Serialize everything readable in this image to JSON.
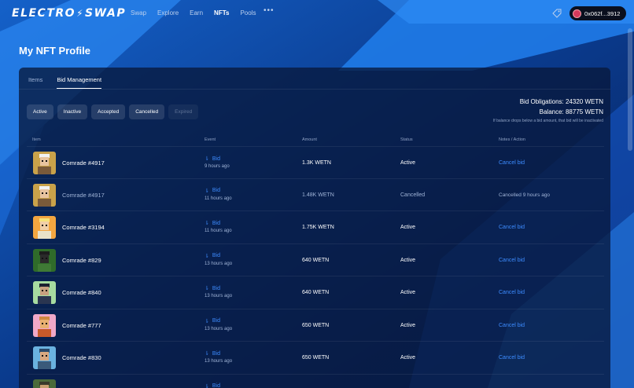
{
  "nav": {
    "logo_left": "ELECTRO",
    "logo_right": "SWAP",
    "links": [
      {
        "label": "Swap",
        "active": false
      },
      {
        "label": "Explore",
        "active": false
      },
      {
        "label": "Earn",
        "active": false
      },
      {
        "label": "NFTs",
        "active": true
      },
      {
        "label": "Pools",
        "active": false
      }
    ],
    "more_label": "•••",
    "wallet_address": "0x062f...3912"
  },
  "page": {
    "title": "My NFT Profile"
  },
  "tabs": [
    {
      "label": "Items",
      "active": false
    },
    {
      "label": "Bid Management",
      "active": true
    }
  ],
  "filters": [
    {
      "label": "Active",
      "disabled": false
    },
    {
      "label": "Inactive",
      "disabled": false
    },
    {
      "label": "Accepted",
      "disabled": false
    },
    {
      "label": "Cancelled",
      "disabled": false
    },
    {
      "label": "Expired",
      "disabled": true
    }
  ],
  "summary": {
    "obligations": "Bid Obligations: 24320 WETN",
    "balance": "Balance: 88775 WETN",
    "note": "If balance drops below a bid amount, that bid will be inactivated"
  },
  "table": {
    "headers": {
      "item": "Item",
      "event": "Event",
      "amount": "Amount",
      "status": "Status",
      "notes": "Notes / Action"
    },
    "rows": [
      {
        "name": "Comrade #4917",
        "event": "Bid",
        "time": "9 hours ago",
        "amount": "1.3K WETN",
        "status": "Active",
        "action": "Cancel bid",
        "muted": false,
        "avatar": {
          "bg": "#c9a24a",
          "skin": "#e8c4a0",
          "hair": "#f2f2f2",
          "shirt": "#7a5a3a"
        }
      },
      {
        "name": "Comrade #4917",
        "event": "Bid",
        "time": "11 hours ago",
        "amount": "1.48K WETN",
        "status": "Cancelled",
        "action": "Cancelled 9 hours ago",
        "muted": true,
        "avatar": {
          "bg": "#c9a24a",
          "skin": "#e8c4a0",
          "hair": "#f2f2f2",
          "shirt": "#7a5a3a"
        }
      },
      {
        "name": "Comrade #3194",
        "event": "Bid",
        "time": "11 hours ago",
        "amount": "1.75K WETN",
        "status": "Active",
        "action": "Cancel bid",
        "muted": false,
        "avatar": {
          "bg": "#f3a640",
          "skin": "#f0cfa8",
          "hair": "#f6e27a",
          "shirt": "#e9e1c8"
        }
      },
      {
        "name": "Comrade #829",
        "event": "Bid",
        "time": "13 hours ago",
        "amount": "640 WETN",
        "status": "Active",
        "action": "Cancel bid",
        "muted": false,
        "avatar": {
          "bg": "#2f6b2a",
          "skin": "#2a2a2a",
          "hair": "#1d1d1d",
          "shirt": "#3f7a35"
        }
      },
      {
        "name": "Comrade #840",
        "event": "Bid",
        "time": "13 hours ago",
        "amount": "640 WETN",
        "status": "Active",
        "action": "Cancel bid",
        "muted": false,
        "avatar": {
          "bg": "#a6dba0",
          "skin": "#c7a080",
          "hair": "#1a2030",
          "shirt": "#2a3550"
        }
      },
      {
        "name": "Comrade #777",
        "event": "Bid",
        "time": "13 hours ago",
        "amount": "650 WETN",
        "status": "Active",
        "action": "Cancel bid",
        "muted": false,
        "avatar": {
          "bg": "#f0a8c8",
          "skin": "#e8b070",
          "hair": "#d08840",
          "shirt": "#c85a2a"
        }
      },
      {
        "name": "Comrade #830",
        "event": "Bid",
        "time": "13 hours ago",
        "amount": "650 WETN",
        "status": "Active",
        "action": "Cancel bid",
        "muted": false,
        "avatar": {
          "bg": "#6ab2e0",
          "skin": "#d8a880",
          "hair": "#2a4a6a",
          "shirt": "#3a5a7a"
        }
      },
      {
        "name": "",
        "event": "Bid",
        "time": "",
        "amount": "",
        "status": "",
        "action": "",
        "muted": false,
        "avatar": {
          "bg": "#4a6a3a",
          "skin": "#c8a070",
          "hair": "#3a3a2a",
          "shirt": "#5a5a4a"
        }
      }
    ]
  },
  "colors": {
    "accent": "#3d8cff",
    "panel": "#08183c",
    "background": "#0c3f8f"
  }
}
